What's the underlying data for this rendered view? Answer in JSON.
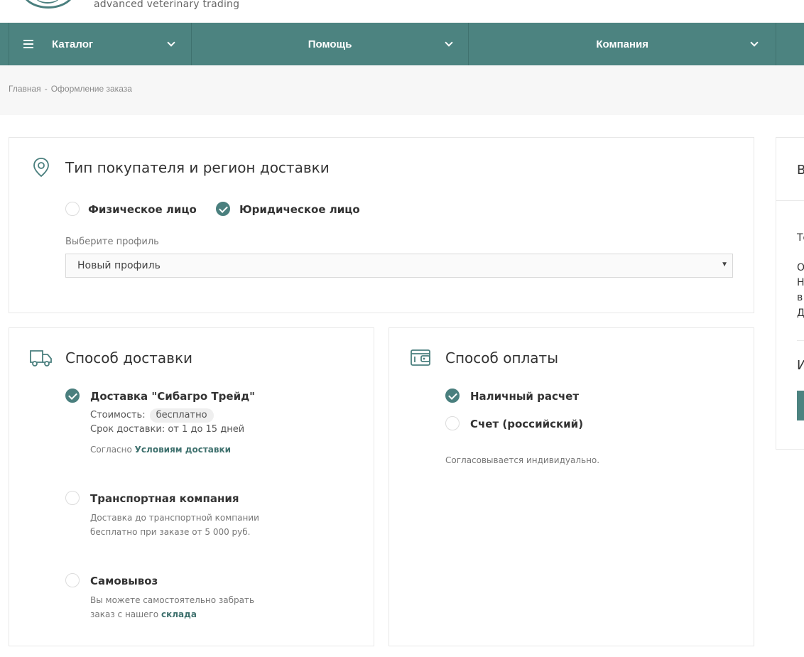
{
  "header": {
    "tagline": "advanced veterinary trading"
  },
  "nav": {
    "catalog": "Каталог",
    "help": "Помощь",
    "company": "Компания"
  },
  "breadcrumb": {
    "home": "Главная",
    "separator": "-",
    "current": "Оформление заказа"
  },
  "buyer": {
    "title": "Тип покупателя и регион доставки",
    "option_individual": "Физическое лицо",
    "option_legal": "Юридическое лицо",
    "selected": "Юридическое лицо",
    "profile_label": "Выберите профиль",
    "profile_value": "Новый профиль"
  },
  "delivery": {
    "title": "Способ доставки",
    "options": [
      {
        "label": "Доставка \"Сибагро Трейд\"",
        "checked": true,
        "cost_label": "Стоимость:",
        "cost_value": "бесплатно",
        "term_label": "Срок доставки:",
        "term_value": "от 1 до 15 дней",
        "terms_prefix": "Согласно",
        "terms_link": "Условиям доставки"
      },
      {
        "label": "Транспортная компания",
        "checked": false,
        "desc_line1": "Доставка до транспортной компании",
        "desc_line2": "бесплатно при заказе от 5 000 руб."
      },
      {
        "label": "Самовывоз",
        "checked": false,
        "desc_line1": "Вы можете самостоятельно забрать",
        "desc_line2_prefix": "заказ с нашего",
        "desc_link": "склада"
      }
    ]
  },
  "payment": {
    "title": "Способ оплаты",
    "options": [
      {
        "label": "Наличный расчет",
        "checked": true
      },
      {
        "label": "Счет (российский)",
        "checked": false
      }
    ],
    "note": "Согласовывается индивидуально."
  },
  "summary": {
    "heading_fragment": "В",
    "line1": "То",
    "line2": "О",
    "line3": "Н",
    "line4": "в",
    "line5": "Д",
    "total_fragment": "И"
  },
  "colors": {
    "accent": "#4c8380",
    "accent_dark": "#3f716e",
    "breadcrumb_bg": "#f7f7f7"
  }
}
